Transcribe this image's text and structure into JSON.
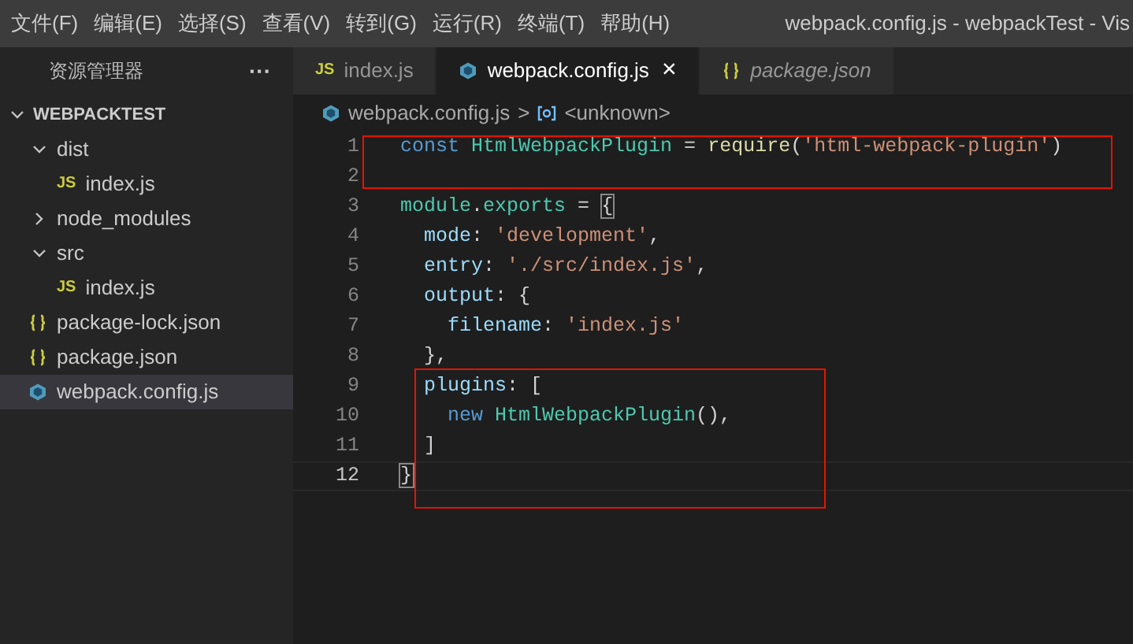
{
  "menu_bar": {
    "items": [
      "文件(F)",
      "编辑(E)",
      "选择(S)",
      "查看(V)",
      "转到(G)",
      "运行(R)",
      "终端(T)",
      "帮助(H)"
    ],
    "title": "webpack.config.js - webpackTest - Vis"
  },
  "sidebar": {
    "title": "资源管理器",
    "more": "···",
    "section": {
      "label": "WEBPACKTEST",
      "expanded": true,
      "items": [
        {
          "label": "dist",
          "kind": "folder",
          "expanded": true,
          "selected": false,
          "children": [
            {
              "label": "index.js",
              "kind": "js",
              "icon": "JS",
              "selected": false
            }
          ]
        },
        {
          "label": "node_modules",
          "kind": "folder",
          "expanded": false,
          "selected": false
        },
        {
          "label": "src",
          "kind": "folder",
          "expanded": true,
          "selected": false,
          "children": [
            {
              "label": "index.js",
              "kind": "js",
              "icon": "JS",
              "selected": false
            }
          ]
        },
        {
          "label": "package-lock.json",
          "kind": "json",
          "selected": false
        },
        {
          "label": "package.json",
          "kind": "json",
          "selected": false
        },
        {
          "label": "webpack.config.js",
          "kind": "config",
          "selected": true
        }
      ]
    }
  },
  "tabs": [
    {
      "label": "index.js",
      "kind": "js",
      "icon": "JS",
      "selected": false,
      "preview": false
    },
    {
      "label": "webpack.config.js",
      "kind": "config",
      "selected": true,
      "preview": false,
      "close": "×"
    },
    {
      "label": "package.json",
      "kind": "json",
      "selected": false,
      "preview": true
    }
  ],
  "breadcrumb": {
    "file": "webpack.config.js",
    "separator": ">",
    "symbol": "<unknown>"
  },
  "editor": {
    "lines": [
      {
        "number": "1",
        "current": false,
        "tokens": [
          {
            "kind": "keyword",
            "text": "const "
          },
          {
            "kind": "class",
            "text": "HtmlWebpackPlugin"
          },
          {
            "kind": "plain",
            "text": " = "
          },
          {
            "kind": "func",
            "text": "require"
          },
          {
            "kind": "plain",
            "text": "("
          },
          {
            "kind": "string",
            "text": "'html-webpack-plugin'"
          },
          {
            "kind": "plain",
            "text": ")"
          }
        ]
      },
      {
        "number": "2",
        "current": false
      },
      {
        "number": "3",
        "current": false,
        "tokens": [
          {
            "kind": "class",
            "text": "module"
          },
          {
            "kind": "plain",
            "text": "."
          },
          {
            "kind": "class",
            "text": "exports"
          },
          {
            "kind": "plain",
            "text": " = "
          },
          {
            "kind": "bracket",
            "text": "{"
          }
        ]
      },
      {
        "number": "4",
        "current": false,
        "tokens": [
          {
            "kind": "property",
            "text": "  mode"
          },
          {
            "kind": "plain",
            "text": ": "
          },
          {
            "kind": "string",
            "text": "'development'"
          },
          {
            "kind": "plain",
            "text": ","
          }
        ]
      },
      {
        "number": "5",
        "current": false,
        "tokens": [
          {
            "kind": "property",
            "text": "  entry"
          },
          {
            "kind": "plain",
            "text": ": "
          },
          {
            "kind": "string",
            "text": "'./src/index.js'"
          },
          {
            "kind": "plain",
            "text": ","
          }
        ]
      },
      {
        "number": "6",
        "current": false,
        "tokens": [
          {
            "kind": "property",
            "text": "  output"
          },
          {
            "kind": "plain",
            "text": ": {"
          }
        ]
      },
      {
        "number": "7",
        "current": false,
        "tokens": [
          {
            "kind": "property",
            "text": "    filename"
          },
          {
            "kind": "plain",
            "text": ": "
          },
          {
            "kind": "string",
            "text": "'index.js'"
          }
        ]
      },
      {
        "number": "8",
        "current": false,
        "tokens": [
          {
            "kind": "plain",
            "text": "  },"
          }
        ]
      },
      {
        "number": "9",
        "current": false,
        "tokens": [
          {
            "kind": "property",
            "text": "  plugins"
          },
          {
            "kind": "plain",
            "text": ": ["
          }
        ]
      },
      {
        "number": "10",
        "current": false,
        "tokens": [
          {
            "kind": "keyword",
            "text": "    new "
          },
          {
            "kind": "class",
            "text": "HtmlWebpackPlugin"
          },
          {
            "kind": "plain",
            "text": "(),"
          }
        ]
      },
      {
        "number": "11",
        "current": false,
        "tokens": [
          {
            "kind": "plain",
            "text": "  ]"
          }
        ]
      },
      {
        "number": "12",
        "current": true,
        "tokens": [
          {
            "kind": "bracket",
            "text": "}"
          }
        ]
      }
    ]
  }
}
